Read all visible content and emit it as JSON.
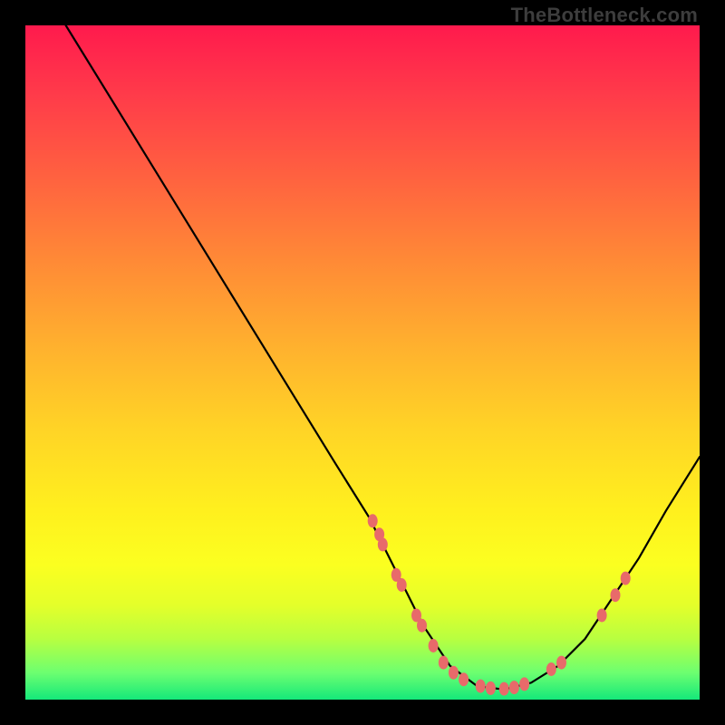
{
  "watermark": "TheBottleneck.com",
  "colors": {
    "marker": "#e86a6a",
    "curve": "#000000"
  },
  "chart_data": {
    "type": "line",
    "title": "",
    "xlabel": "",
    "ylabel": "",
    "xlim": [
      0,
      100
    ],
    "ylim": [
      0,
      100
    ],
    "description": "Bottleneck curve: steep descent from top-left, minimum near x≈70, then rising toward right edge. Green band at bottom ≈ optimal region.",
    "curve_points": [
      {
        "x": 6.0,
        "y": 100.0
      },
      {
        "x": 14.0,
        "y": 87.0
      },
      {
        "x": 22.0,
        "y": 74.0
      },
      {
        "x": 30.0,
        "y": 61.0
      },
      {
        "x": 38.0,
        "y": 48.0
      },
      {
        "x": 46.0,
        "y": 35.0
      },
      {
        "x": 51.0,
        "y": 27.0
      },
      {
        "x": 55.0,
        "y": 19.0
      },
      {
        "x": 59.0,
        "y": 11.0
      },
      {
        "x": 63.0,
        "y": 5.0
      },
      {
        "x": 67.0,
        "y": 2.0
      },
      {
        "x": 71.0,
        "y": 1.5
      },
      {
        "x": 75.0,
        "y": 2.5
      },
      {
        "x": 79.0,
        "y": 5.0
      },
      {
        "x": 83.0,
        "y": 9.0
      },
      {
        "x": 87.0,
        "y": 15.0
      },
      {
        "x": 91.0,
        "y": 21.0
      },
      {
        "x": 95.0,
        "y": 28.0
      },
      {
        "x": 100.0,
        "y": 36.0
      }
    ],
    "markers": [
      {
        "x": 51.5,
        "y": 26.5
      },
      {
        "x": 52.5,
        "y": 24.5
      },
      {
        "x": 53.0,
        "y": 23.0
      },
      {
        "x": 55.0,
        "y": 18.5
      },
      {
        "x": 55.8,
        "y": 17.0
      },
      {
        "x": 58.0,
        "y": 12.5
      },
      {
        "x": 58.8,
        "y": 11.0
      },
      {
        "x": 60.5,
        "y": 8.0
      },
      {
        "x": 62.0,
        "y": 5.5
      },
      {
        "x": 63.5,
        "y": 4.0
      },
      {
        "x": 65.0,
        "y": 3.0
      },
      {
        "x": 67.5,
        "y": 2.0
      },
      {
        "x": 69.0,
        "y": 1.7
      },
      {
        "x": 71.0,
        "y": 1.6
      },
      {
        "x": 72.5,
        "y": 1.8
      },
      {
        "x": 74.0,
        "y": 2.3
      },
      {
        "x": 78.0,
        "y": 4.5
      },
      {
        "x": 79.5,
        "y": 5.5
      },
      {
        "x": 85.5,
        "y": 12.5
      },
      {
        "x": 87.5,
        "y": 15.5
      },
      {
        "x": 89.0,
        "y": 18.0
      }
    ]
  }
}
